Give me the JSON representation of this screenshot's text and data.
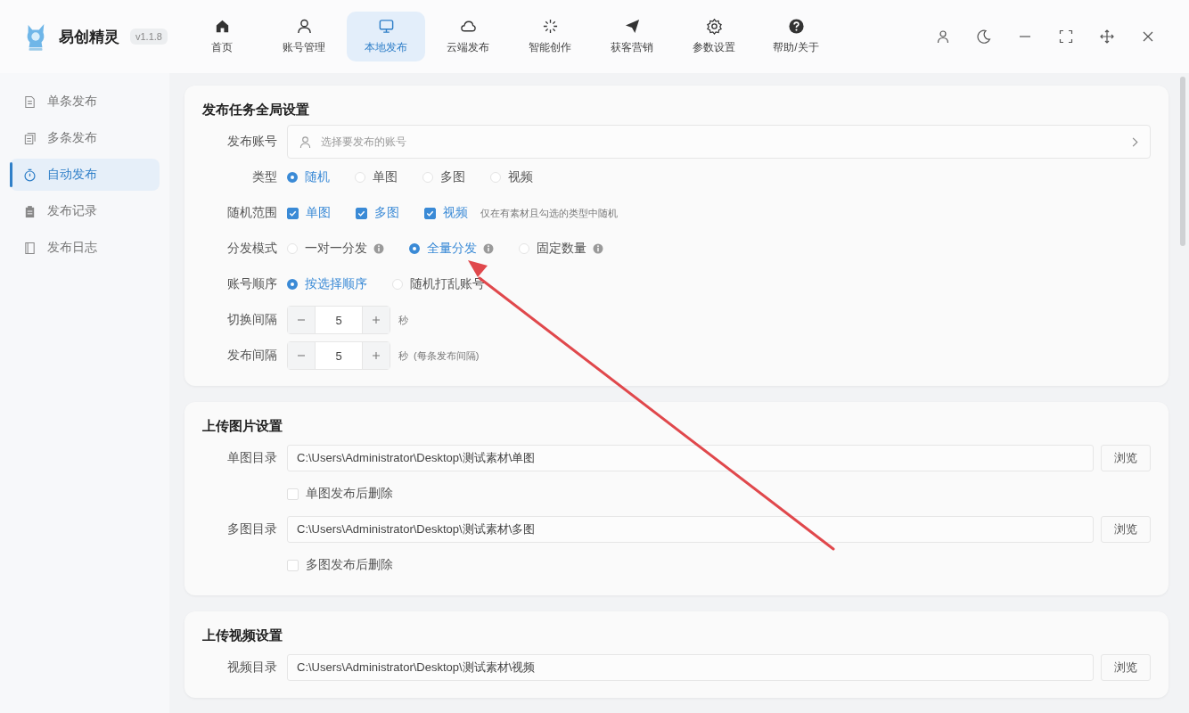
{
  "app": {
    "name": "易创精灵",
    "version": "v1.1.8"
  },
  "nav": [
    {
      "label": "首页",
      "selected": false
    },
    {
      "label": "账号管理",
      "selected": false
    },
    {
      "label": "本地发布",
      "selected": true
    },
    {
      "label": "云端发布",
      "selected": false
    },
    {
      "label": "智能创作",
      "selected": false
    },
    {
      "label": "获客营销",
      "selected": false
    },
    {
      "label": "参数设置",
      "selected": false
    },
    {
      "label": "帮助/关于",
      "selected": false
    }
  ],
  "sidebar": [
    {
      "label": "单条发布",
      "selected": false
    },
    {
      "label": "多条发布",
      "selected": false
    },
    {
      "label": "自动发布",
      "selected": true
    },
    {
      "label": "发布记录",
      "selected": false
    },
    {
      "label": "发布日志",
      "selected": false
    }
  ],
  "sections": [
    {
      "title": "发布任务全局设置",
      "rows": [
        {
          "kind": "select",
          "label": "发布账号",
          "placeholder": "选择要发布的账号"
        },
        {
          "kind": "radio",
          "label": "类型",
          "options": [
            {
              "label": "随机",
              "selected": true
            },
            {
              "label": "单图",
              "selected": false
            },
            {
              "label": "多图",
              "selected": false
            },
            {
              "label": "视频",
              "selected": false
            }
          ]
        },
        {
          "kind": "checks",
          "label": "随机范围",
          "options": [
            {
              "label": "单图",
              "checked": true
            },
            {
              "label": "多图",
              "checked": true
            },
            {
              "label": "视频",
              "checked": true
            }
          ],
          "hint": "仅在有素材且勾选的类型中随机"
        },
        {
          "kind": "radio",
          "label": "分发模式",
          "options": [
            {
              "label": "一对一分发",
              "selected": false,
              "info": true
            },
            {
              "label": "全量分发",
              "selected": true,
              "info": true
            },
            {
              "label": "固定数量",
              "selected": false,
              "info": true
            }
          ]
        },
        {
          "kind": "radio",
          "label": "账号顺序",
          "options": [
            {
              "label": "按选择顺序",
              "selected": true
            },
            {
              "label": "随机打乱账号",
              "selected": false
            }
          ]
        },
        {
          "kind": "stepper",
          "label": "切换间隔",
          "value": "5",
          "unit": "秒"
        },
        {
          "kind": "stepper",
          "label": "发布间隔",
          "value": "5",
          "unit": "秒",
          "note": "(每条发布间隔)"
        }
      ]
    },
    {
      "title": "上传图片设置",
      "rows": [
        {
          "kind": "path",
          "label": "单图目录",
          "value": "C:\\Users\\Administrator\\Desktop\\测试素材\\单图",
          "button": "浏览"
        },
        {
          "kind": "check",
          "label": "单图发布后删除",
          "checked": false
        },
        {
          "kind": "path",
          "label": "多图目录",
          "value": "C:\\Users\\Administrator\\Desktop\\测试素材\\多图",
          "button": "浏览"
        },
        {
          "kind": "check",
          "label": "多图发布后删除",
          "checked": false
        }
      ]
    },
    {
      "title": "上传视频设置",
      "rows": [
        {
          "kind": "path",
          "label": "视频目录",
          "value": "C:\\Users\\Administrator\\Desktop\\测试素材\\视频",
          "button": "浏览"
        }
      ]
    }
  ]
}
